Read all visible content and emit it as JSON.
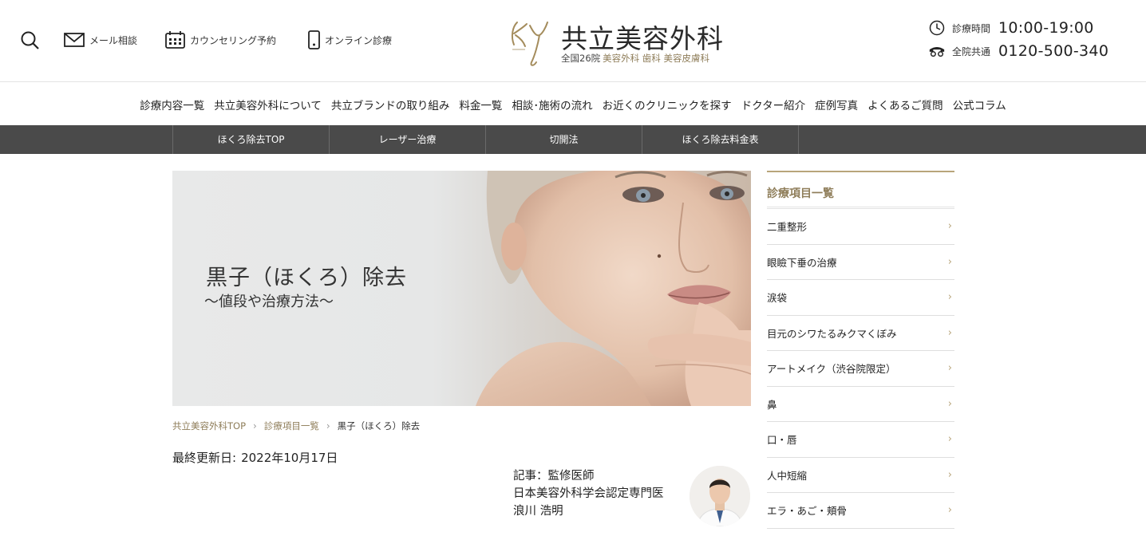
{
  "header": {
    "mail_label": "メール相談",
    "counseling_label": "カウンセリング予約",
    "online_label": "オンライン診療",
    "logo_name": "共立美容外科",
    "logo_sub_main": "全国26院",
    "logo_sub_tags": "美容外科 歯科 美容皮膚科",
    "hours_label": "診療時間",
    "hours_value": "10:00-19:00",
    "phone_label": "全院共通",
    "phone_value": "0120-500-340"
  },
  "gnav": [
    "診療内容一覧",
    "共立美容外科について",
    "共立ブランドの取り組み",
    "料金一覧",
    "相談･施術の流れ",
    "お近くのクリニックを探す",
    "ドクター紹介",
    "症例写真",
    "よくあるご質問",
    "公式コラム"
  ],
  "subnav": [
    "ほくろ除去TOP",
    "レーザー治療",
    "切開法",
    "ほくろ除去料金表"
  ],
  "hero": {
    "title": "黒子（ほくろ）除去",
    "subtitle": "〜値段や治療方法〜"
  },
  "breadcrumb": {
    "home": "共立美容外科TOP",
    "list": "診療項目一覧",
    "current": "黒子（ほくろ）除去"
  },
  "updated": {
    "label": "最終更新日:",
    "date": "2022年10月17日"
  },
  "author": {
    "line1": "記事：監修医師",
    "line2": "日本美容外科学会認定専門医",
    "line3": "浪川 浩明"
  },
  "sidebar": {
    "title": "診療項目一覧",
    "items": [
      "二重整形",
      "眼瞼下垂の治療",
      "涙袋",
      "目元のシワたるみクマくぼみ",
      "アートメイク（渋谷院限定）",
      "鼻",
      "口・唇",
      "人中短縮",
      "エラ・あご・頬骨"
    ]
  },
  "colors": {
    "gold": "#8f7e5a",
    "subnav_bg": "#4a4a4a"
  }
}
